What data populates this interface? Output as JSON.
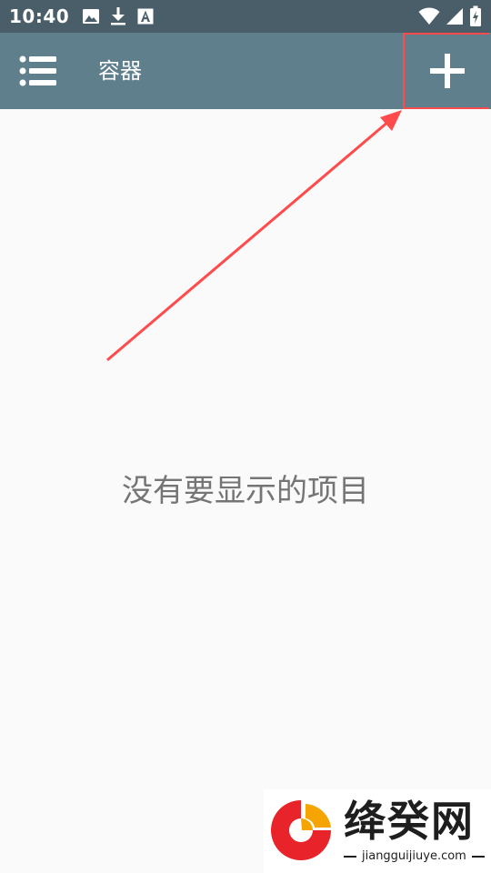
{
  "status_bar": {
    "time": "10:40",
    "left_icons": [
      "image-icon",
      "download-icon",
      "font-icon"
    ],
    "right_icons": [
      "wifi-icon",
      "signal-icon",
      "battery-icon"
    ]
  },
  "app_bar": {
    "title": "容器",
    "menu_icon": "menu-list-icon",
    "add_icon": "plus-icon",
    "background": "#5f7f8c"
  },
  "content": {
    "empty_message": "没有要显示的项目"
  },
  "annotation": {
    "color": "#ff4b4b"
  },
  "watermark": {
    "name": "绛癸网",
    "url": "jiangguijiuye.com"
  }
}
